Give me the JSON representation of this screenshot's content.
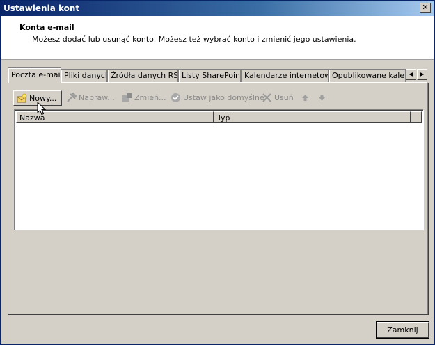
{
  "window": {
    "title": "Ustawienia kont",
    "close_glyph": "✕"
  },
  "header": {
    "title": "Konta e-mail",
    "description": "Możesz dodać lub usunąć konto. Możesz też wybrać konto i zmienić jego ustawienia."
  },
  "tabs": [
    {
      "label": "Poczta e-mail",
      "active": true
    },
    {
      "label": "Pliki danych",
      "active": false
    },
    {
      "label": "Źródła danych RSS",
      "active": false
    },
    {
      "label": "Listy SharePoint",
      "active": false
    },
    {
      "label": "Kalendarze internetowe",
      "active": false
    },
    {
      "label": "Opublikowane kalendarze",
      "active": false
    }
  ],
  "tab_scroll": {
    "left": "◀",
    "right": "▶"
  },
  "toolbar": {
    "new_label": "Nowy...",
    "repair_label": "Napraw...",
    "change_label": "Zmień...",
    "default_label": "Ustaw jako domyślne",
    "remove_label": "Usuń",
    "up_icon": "arrow-up-icon",
    "down_icon": "arrow-down-icon"
  },
  "list": {
    "columns": [
      "Nazwa",
      "Typ"
    ],
    "rows": []
  },
  "footer": {
    "close_label": "Zamknij"
  },
  "colors": {
    "titlebar_start": "#0a246a",
    "titlebar_end": "#a6caf0",
    "face": "#d4d0c8",
    "disabled_text": "#8a8a8a"
  }
}
